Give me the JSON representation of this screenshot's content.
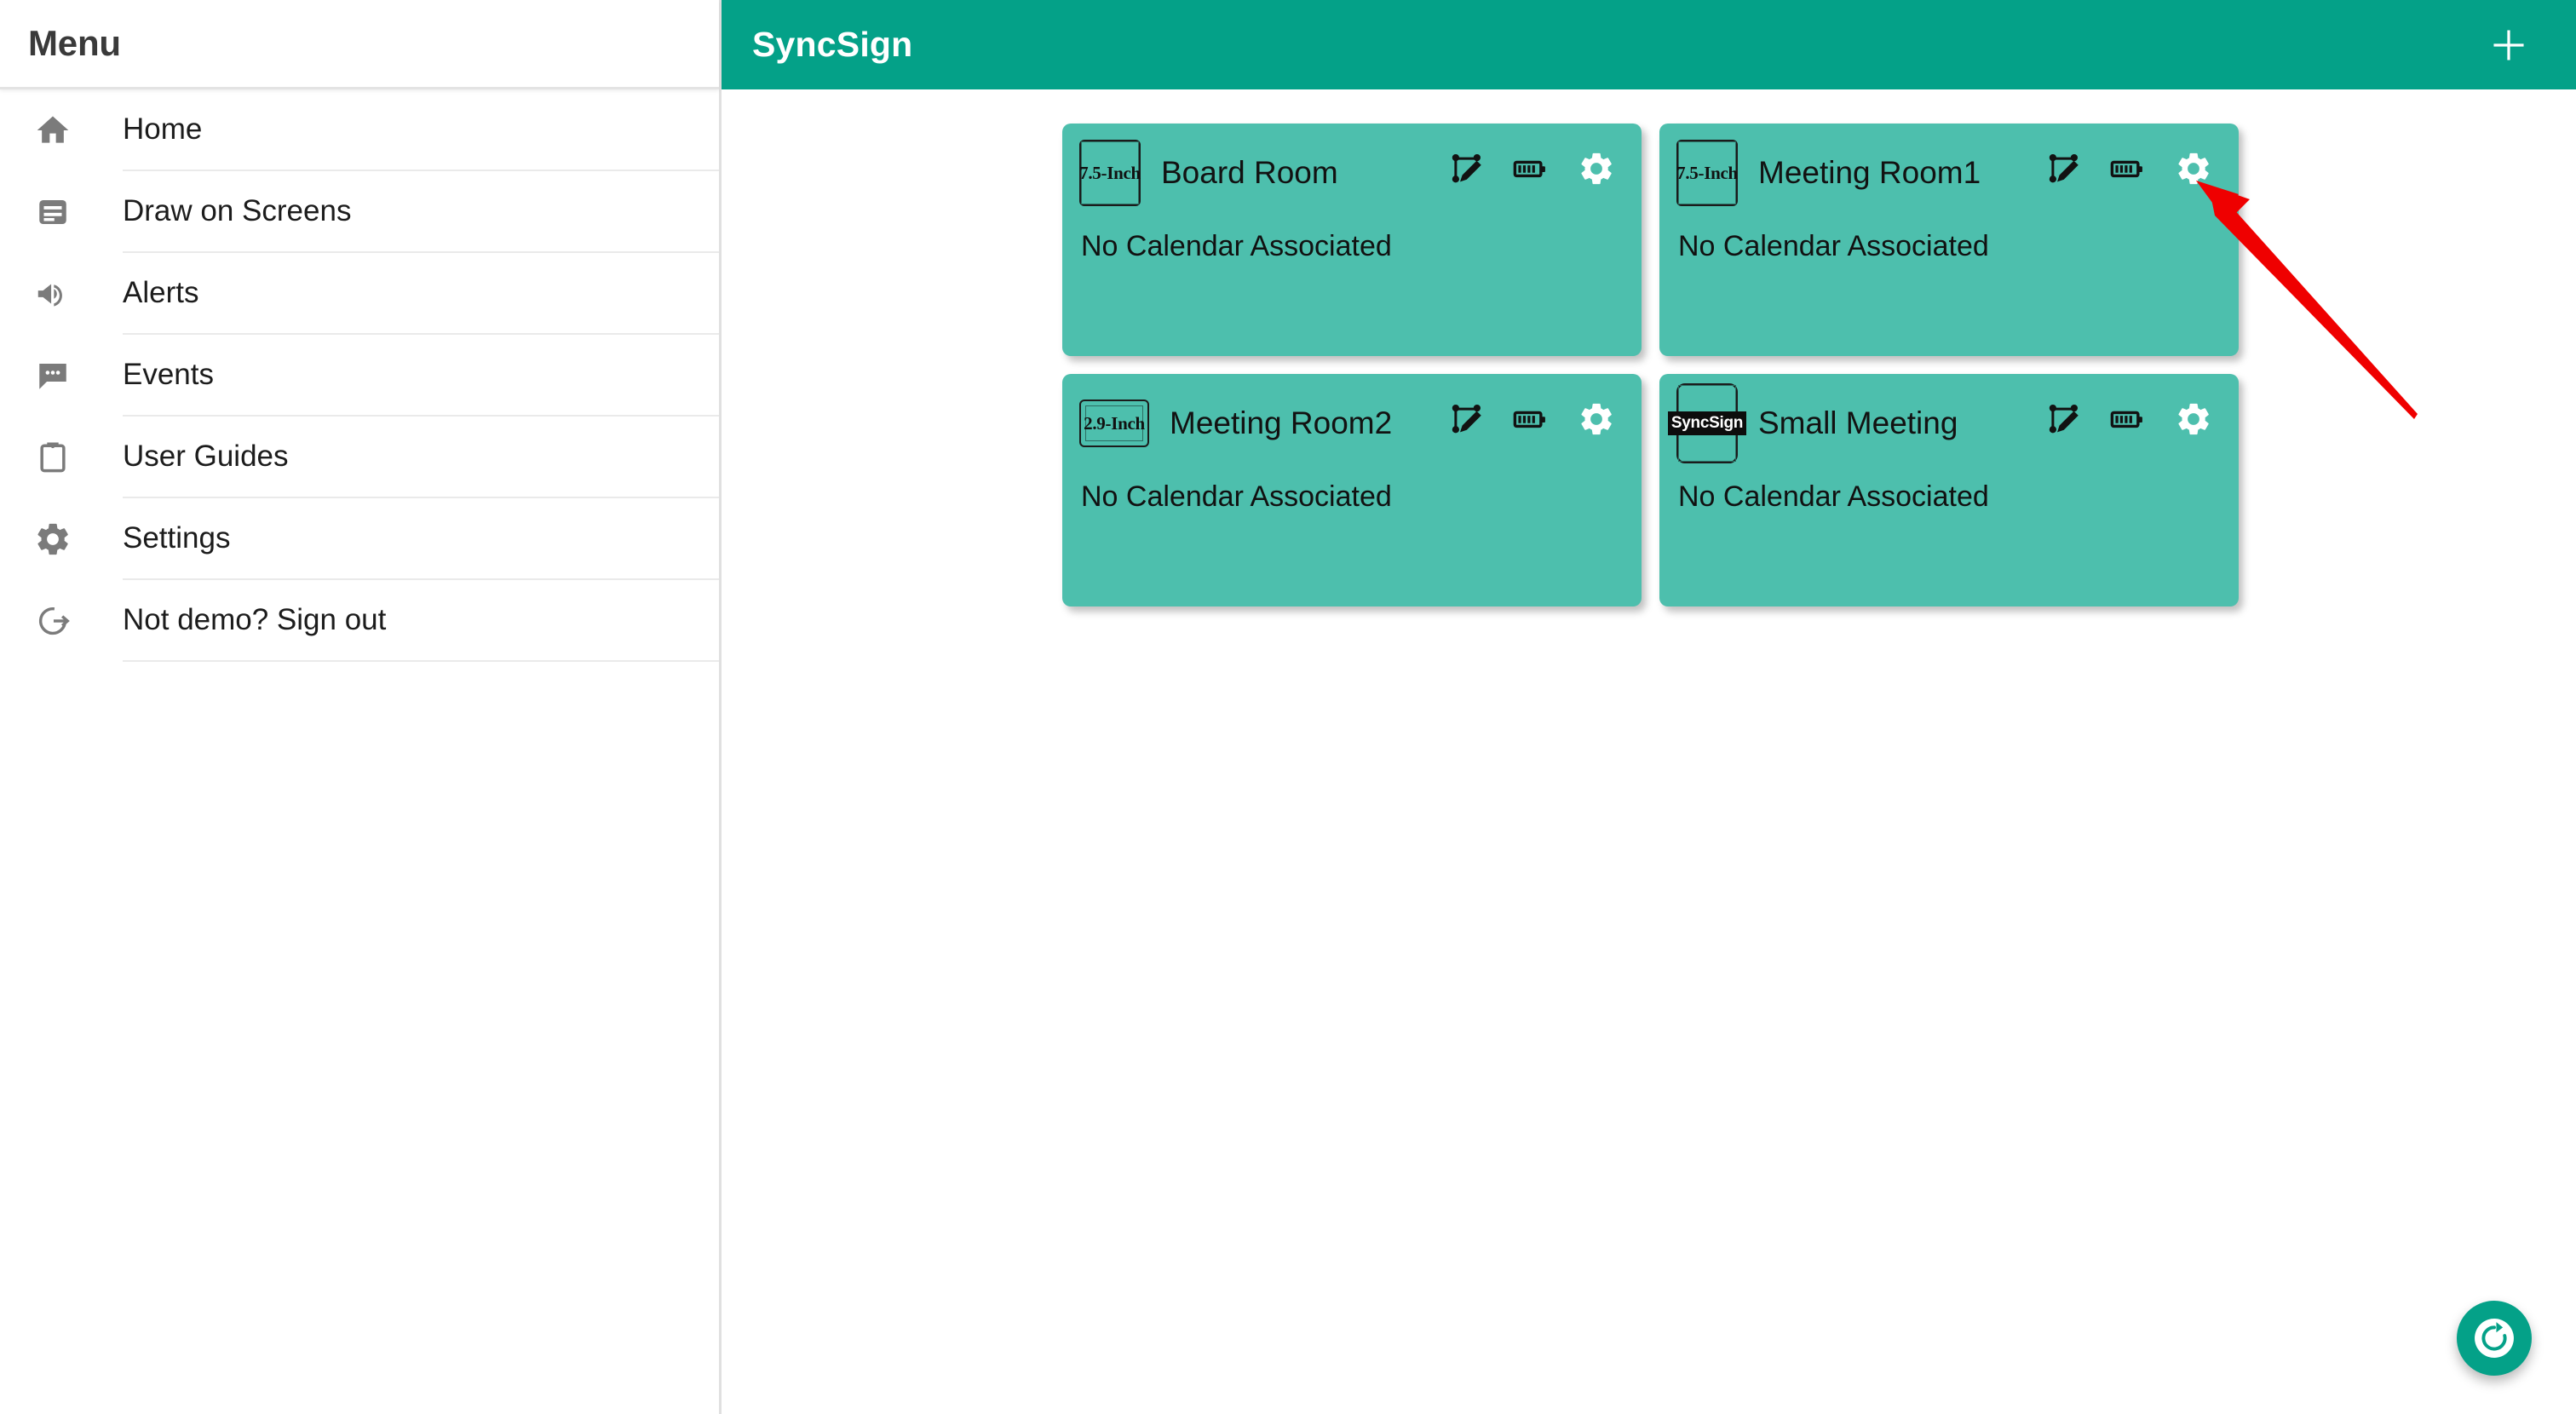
{
  "sidebar": {
    "title": "Menu",
    "items": [
      {
        "label": "Home",
        "icon": "home-icon"
      },
      {
        "label": "Draw on Screens",
        "icon": "article-icon"
      },
      {
        "label": "Alerts",
        "icon": "campaign-icon"
      },
      {
        "label": "Events",
        "icon": "chat-icon"
      },
      {
        "label": "User Guides",
        "icon": "clipboard-icon"
      },
      {
        "label": "Settings",
        "icon": "gear-icon"
      },
      {
        "label": "Not demo? Sign out",
        "icon": "sign-out-icon"
      }
    ]
  },
  "header": {
    "title": "SyncSign",
    "add_label": "+",
    "accent_color": "#04A188"
  },
  "main": {
    "card_color": "#4DBFAD",
    "cards": [
      {
        "badge": "7.5-Inch",
        "badge_shape": "portrait",
        "name": "Board Room",
        "status": "No Calendar Associated",
        "icons": [
          "draw-icon",
          "battery-icon",
          "gear-icon"
        ]
      },
      {
        "badge": "7.5-Inch",
        "badge_shape": "portrait",
        "name": "Meeting Room1",
        "status": "No Calendar Associated",
        "icons": [
          "draw-icon",
          "battery-icon",
          "gear-icon"
        ]
      },
      {
        "badge": "2.9-Inch",
        "badge_shape": "landscape",
        "name": "Meeting Room2",
        "status": "No Calendar Associated",
        "icons": [
          "draw-icon",
          "battery-icon",
          "gear-icon"
        ]
      },
      {
        "badge": "SyncSign",
        "badge_shape": "phone",
        "name": "Small Meeting",
        "status": "No Calendar Associated",
        "icons": [
          "draw-icon",
          "battery-icon",
          "gear-icon"
        ]
      }
    ]
  },
  "fab": {
    "icon": "refresh-icon"
  },
  "annotation": {
    "color": "#ef0000",
    "target": "gear-icon-meeting-room1"
  }
}
